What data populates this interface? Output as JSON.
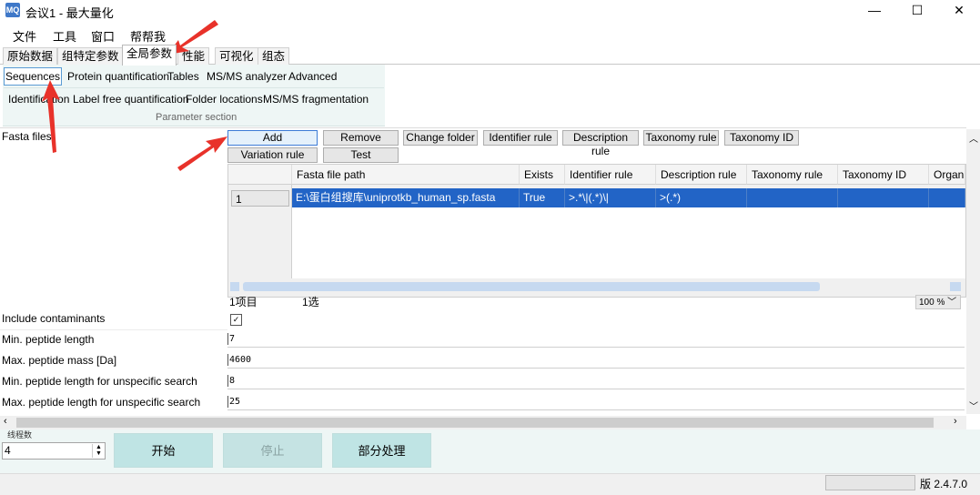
{
  "window": {
    "title": "会议1 - 最大量化",
    "minimize": "—",
    "maximize": "☐",
    "close": "✕"
  },
  "menu": [
    "文件",
    "工具",
    "窗口",
    "帮帮我"
  ],
  "main_tabs": [
    "原始数据",
    "组特定参数",
    "全局参数",
    "性能",
    "可视化",
    "组态"
  ],
  "ribbon": {
    "row1": [
      "Sequences",
      "Protein quantification",
      "Tables",
      "MS/MS analyzer",
      "Advanced"
    ],
    "row2": [
      "Identification",
      "Label free quantification",
      "Folder locations",
      "MS/MS fragmentation"
    ],
    "section_label": "Parameter section"
  },
  "fasta": {
    "label": "Fasta files",
    "buttons": {
      "add": "Add",
      "remove": "Remove",
      "change_folder": "Change folder",
      "identifier_rule": "Identifier rule",
      "description_rule": "Description rule",
      "taxonomy_rule": "Taxonomy rule",
      "taxonomy_id": "Taxonomy ID",
      "variation_rule": "Variation rule",
      "test": "Test"
    },
    "columns": [
      "Fasta file path",
      "Exists",
      "Identifier rule",
      "Description rule",
      "Taxonomy rule",
      "Taxonomy ID",
      "Organi"
    ],
    "rows": [
      {
        "num": "1",
        "path": "E:\\蛋白组搜库\\uniprotkb_human_sp.fasta",
        "exists": "True",
        "identifier_rule": ">.*\\|(.*)\\|",
        "description_rule": ">(.*)",
        "taxonomy_rule": "",
        "taxonomy_id": "",
        "organism": ""
      }
    ],
    "footer_items": "1项目",
    "footer_selected": "1选",
    "zoom": "100 %"
  },
  "params": [
    {
      "label": "Include contaminants",
      "value": "checked"
    },
    {
      "label": "Min. peptide length",
      "value": "7"
    },
    {
      "label": "Max. peptide mass [Da]",
      "value": "4600"
    },
    {
      "label": "Min. peptide length for unspecific search",
      "value": "8"
    },
    {
      "label": "Max. peptide length for unspecific search",
      "value": "25"
    }
  ],
  "bottom": {
    "threads_label": "线程数",
    "threads_value": "4",
    "start": "开始",
    "stop": "停止",
    "partial": "部分处理"
  },
  "status": {
    "version": "版 2.4.7.0"
  },
  "colors": {
    "selection": "#2264c6",
    "ribbon_bg": "#eef6f5",
    "big_button": "#bfe4e4",
    "arrow": "#e8322a"
  }
}
